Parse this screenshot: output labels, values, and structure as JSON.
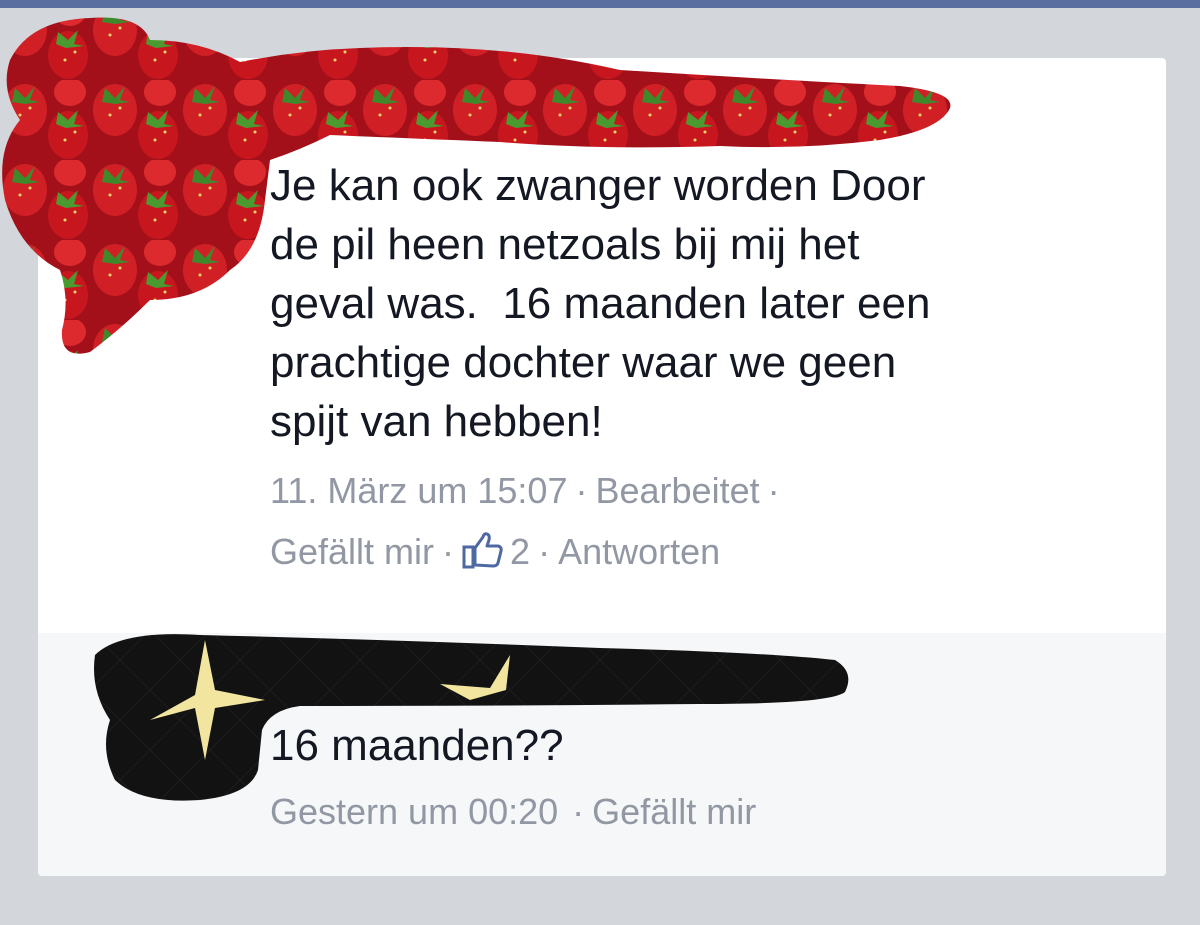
{
  "comment": {
    "lines": [
      "Je kan ook zwanger worden Door",
      "de pil heen netzoals bij mij het",
      "geval was.  16 maanden later een",
      "prachtige dochter waar we geen",
      "spijt van hebben!"
    ],
    "timestamp": "11. März um 15:07",
    "edited": "Bearbeitet",
    "sep": "·",
    "like_label": "Gefällt mir",
    "like_count": "2",
    "reply_label": "Antworten"
  },
  "reply": {
    "text": "16 maanden??",
    "timestamp": "Gestern um 00:20",
    "sep": "·",
    "like_label": "Gefällt mir"
  },
  "icons": {
    "like": "thumbs-up-icon",
    "redaction_top": "strawberry-redaction",
    "redaction_bottom": "star-redaction"
  },
  "colors": {
    "accent_blue": "#4e69a2",
    "meta_gray": "#9197a3",
    "text": "#141823",
    "redaction_red": "#c0141c",
    "redaction_black": "#111111"
  }
}
